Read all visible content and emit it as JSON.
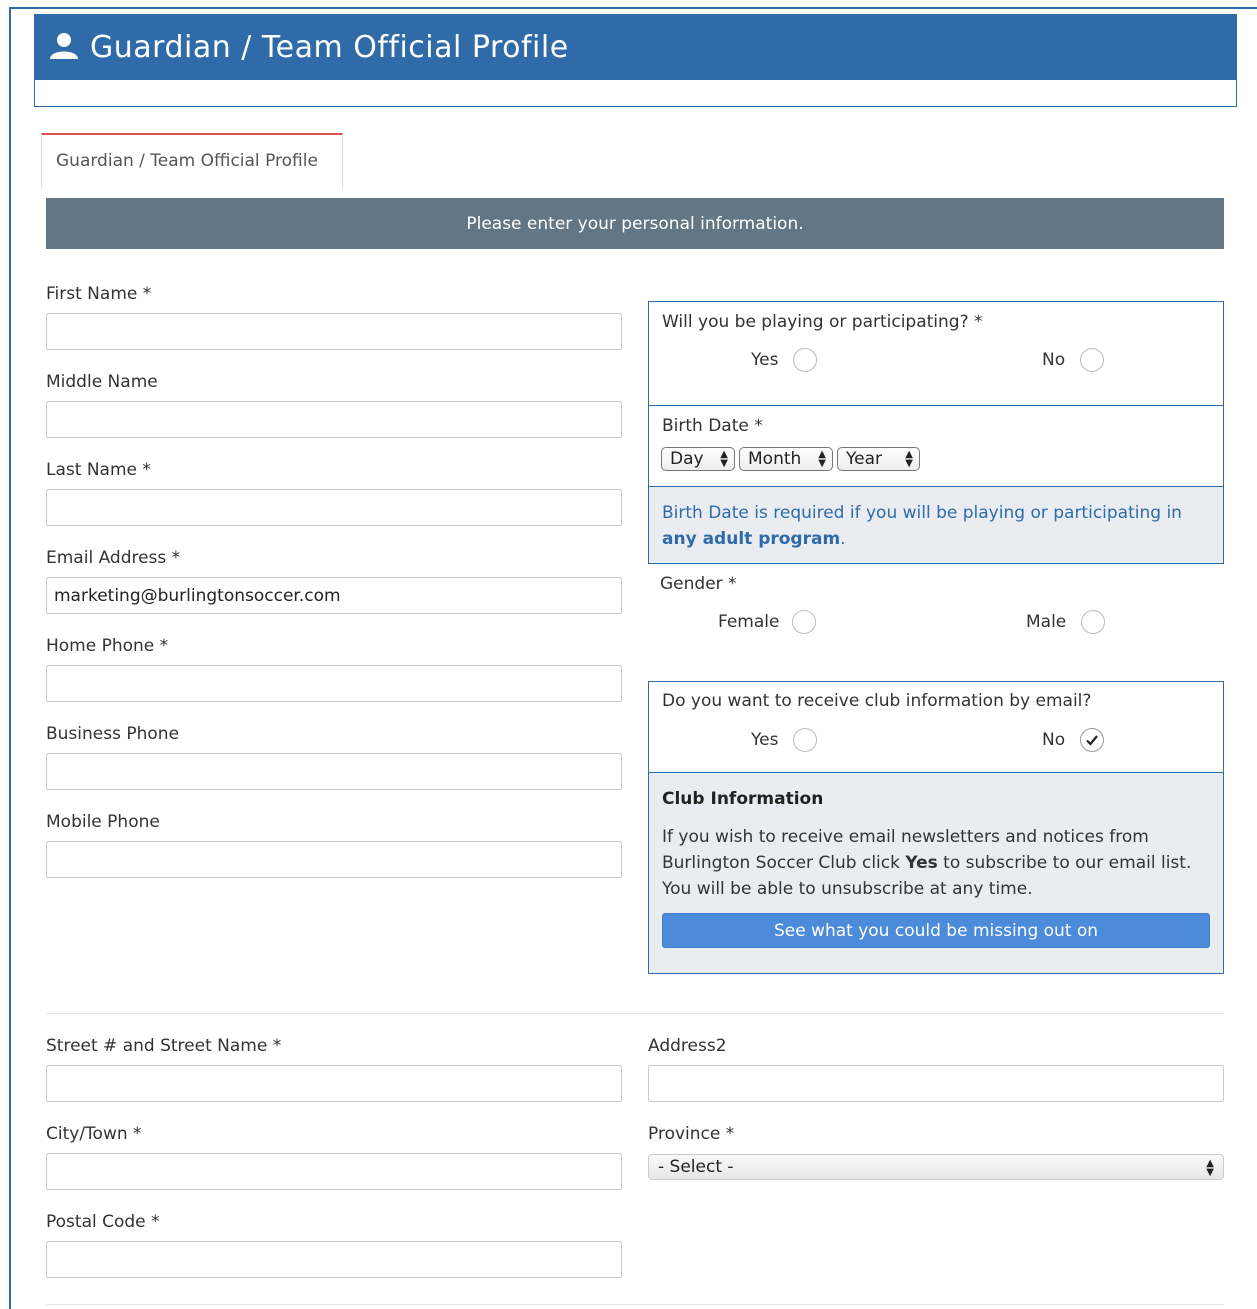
{
  "header": {
    "title": "Guardian / Team Official Profile",
    "icon": "user-icon"
  },
  "tabs": [
    {
      "label": "Guardian / Team Official Profile",
      "active": true
    }
  ],
  "info_bar": "Please enter your personal information.",
  "left_fields": {
    "first_name": {
      "label": "First Name *",
      "value": ""
    },
    "middle_name": {
      "label": "Middle Name",
      "value": ""
    },
    "last_name": {
      "label": "Last Name *",
      "value": ""
    },
    "email": {
      "label": "Email Address *",
      "value": "marketing@burlingtonsoccer.com"
    },
    "home_phone": {
      "label": "Home Phone *",
      "value": ""
    },
    "business_phone": {
      "label": "Business Phone",
      "value": ""
    },
    "mobile_phone": {
      "label": "Mobile Phone",
      "value": ""
    }
  },
  "participating": {
    "question": "Will you be playing or participating? *",
    "yes": "Yes",
    "no": "No"
  },
  "birth_date": {
    "label": "Birth Date *",
    "day": "Day",
    "month": "Month",
    "year": "Year",
    "note_part1": "Birth Date is required if you will be playing or participating in ",
    "note_bold": "any adult program",
    "note_end": "."
  },
  "gender": {
    "label": "Gender *",
    "female": "Female",
    "male": "Male"
  },
  "club_email": {
    "question": "Do you want to receive club information by email?",
    "yes": "Yes",
    "no": "No",
    "selected": "No"
  },
  "club_info": {
    "title": "Club Information",
    "text_part1": "If you wish to receive email newsletters and notices from Burlington Soccer Club click ",
    "text_bold": "Yes",
    "text_part2": " to subscribe to our email list. You will be able to unsubscribe at any time.",
    "button": "See what you could be missing out on"
  },
  "address": {
    "street": {
      "label": "Street # and Street Name *",
      "value": ""
    },
    "address2": {
      "label": "Address2",
      "value": ""
    },
    "city": {
      "label": "City/Town *",
      "value": ""
    },
    "province": {
      "label": "Province *",
      "value": "- Select -"
    },
    "postal": {
      "label": "Postal Code *",
      "value": ""
    }
  },
  "colors": {
    "header": "#2f6ba8",
    "info_bar": "#637685",
    "button": "#4b8bd9",
    "tab_accent": "#d9534f"
  }
}
